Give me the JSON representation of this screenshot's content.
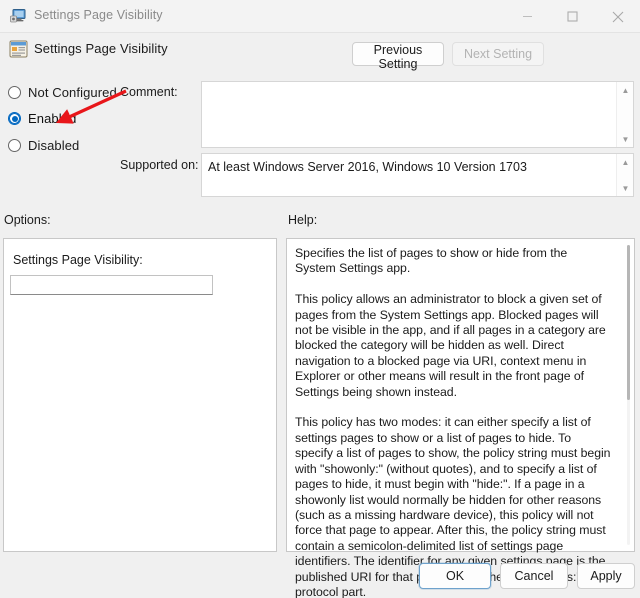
{
  "window": {
    "title": "Settings Page Visibility",
    "icon": "monitor-settings-icon",
    "controls": {
      "minimize": "minimize-icon",
      "maximize": "maximize-icon",
      "close": "close-icon"
    }
  },
  "header": {
    "title": "Settings Page Visibility",
    "icon": "policy-setting-icon",
    "previous_label": "Previous Setting",
    "next_label": "Next Setting"
  },
  "state_options": [
    {
      "label": "Not Configured",
      "checked": false
    },
    {
      "label": "Enabled",
      "checked": true
    },
    {
      "label": "Disabled",
      "checked": false
    }
  ],
  "comment": {
    "label": "Comment:",
    "value": "",
    "placeholder": ""
  },
  "supported_on": {
    "label": "Supported on:",
    "value": "At least Windows Server 2016, Windows 10 Version 1703"
  },
  "options": {
    "label": "Options:",
    "field_label": "Settings Page Visibility:",
    "field_value": "",
    "field_placeholder": ""
  },
  "help": {
    "label": "Help:",
    "text": "Specifies the list of pages to show or hide from the System Settings app.\n\nThis policy allows an administrator to block a given set of pages from the System Settings app. Blocked pages will not be visible in the app, and if all pages in a category are blocked the category will be hidden as well. Direct navigation to a blocked page via URI, context menu in Explorer or other means will result in the front page of Settings being shown instead.\n\nThis policy has two modes: it can either specify a list of settings pages to show or a list of pages to hide. To specify a list of pages to show, the policy string must begin with \"showonly:\" (without quotes), and to specify a list of pages to hide, it must begin with \"hide:\". If a page in a showonly list would normally be hidden for other reasons (such as a missing hardware device), this policy will not force that page to appear. After this, the policy string must contain a semicolon-delimited list of settings page identifiers. The identifier for any given settings page is the published URI for that page, minus the \"ms-settings:\" protocol part."
  },
  "footer": {
    "ok_label": "OK",
    "cancel_label": "Cancel",
    "apply_label": "Apply"
  },
  "annotation": {
    "type": "red-arrow",
    "color": "#e8161a",
    "points_to": "Enabled"
  }
}
